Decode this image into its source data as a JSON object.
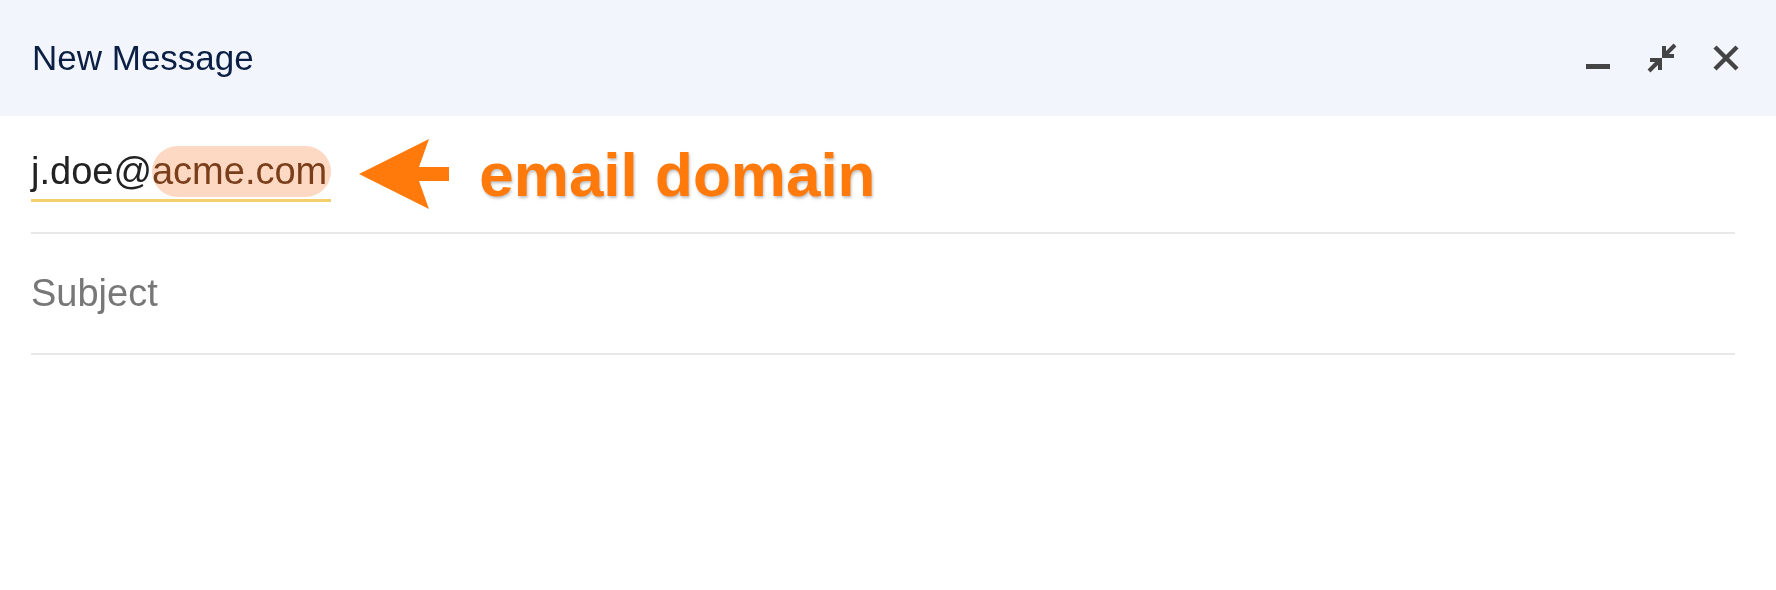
{
  "window": {
    "title": "New Message"
  },
  "recipient": {
    "local_part": "j.doe@",
    "domain": "acme.com",
    "domain_highlighted": true
  },
  "annotation": {
    "label": "email domain"
  },
  "subject": {
    "placeholder": "Subject"
  }
}
